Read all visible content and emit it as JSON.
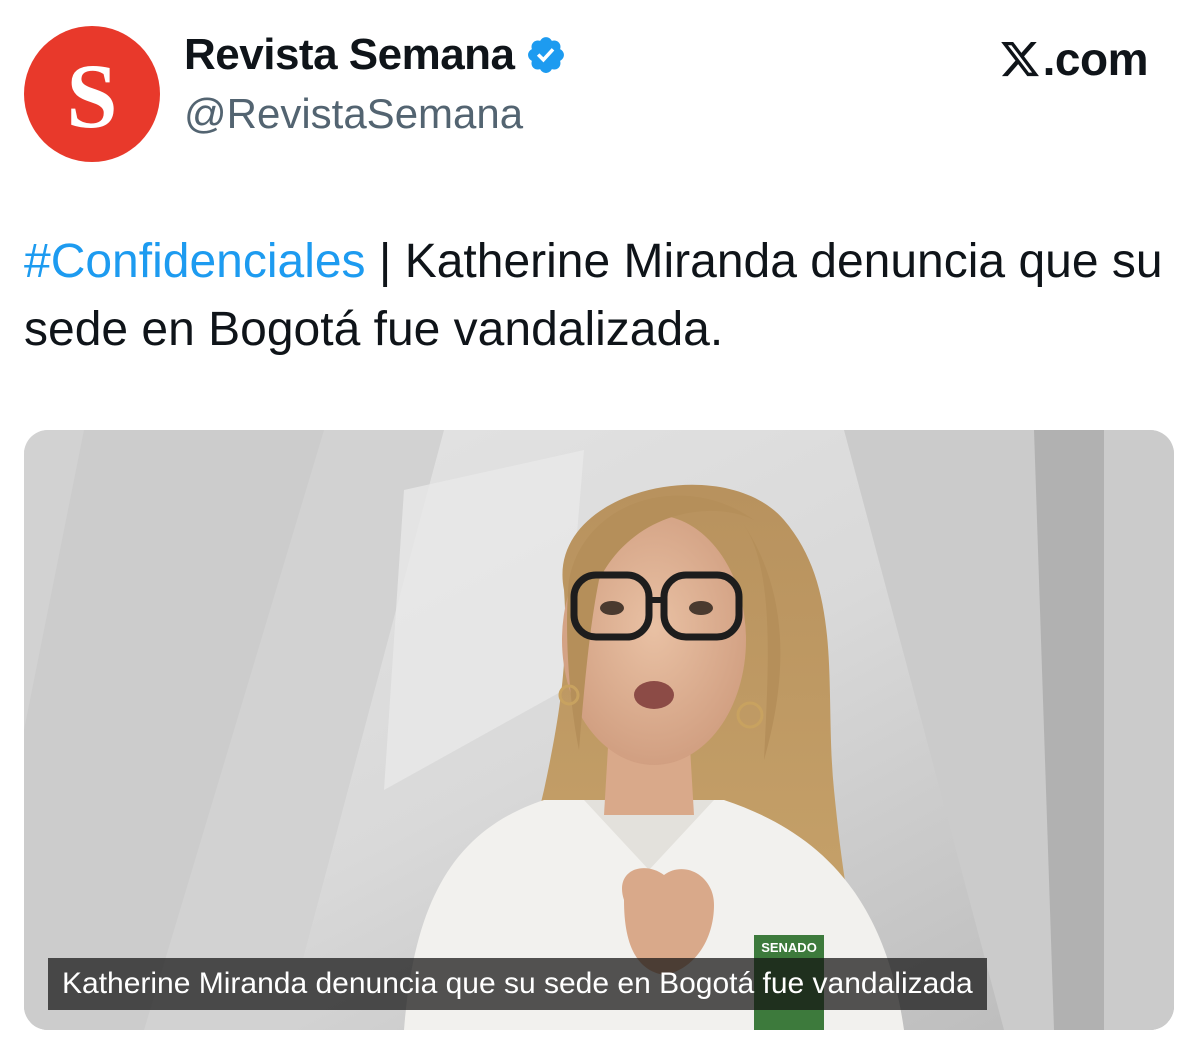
{
  "header": {
    "display_name": "Revista Semana",
    "handle": "@RevistaSemana",
    "avatar_letter": "S",
    "avatar_color": "#e8392b",
    "verified_icon": "verified-badge-icon",
    "verified_color": "#1d9bf0",
    "brand_icon": "x-logo-icon",
    "brand_suffix": ".com"
  },
  "tweet": {
    "hashtag": "#Confidenciales",
    "separator": " | ",
    "body": "Katherine Miranda denuncia que su sede en Bogotá fue vandalizada.",
    "hashtag_color": "#1d9bf0"
  },
  "media": {
    "caption": "Katherine Miranda denuncia que su sede en Bogotá fue vandalizada",
    "badge_text": "SENADO"
  }
}
